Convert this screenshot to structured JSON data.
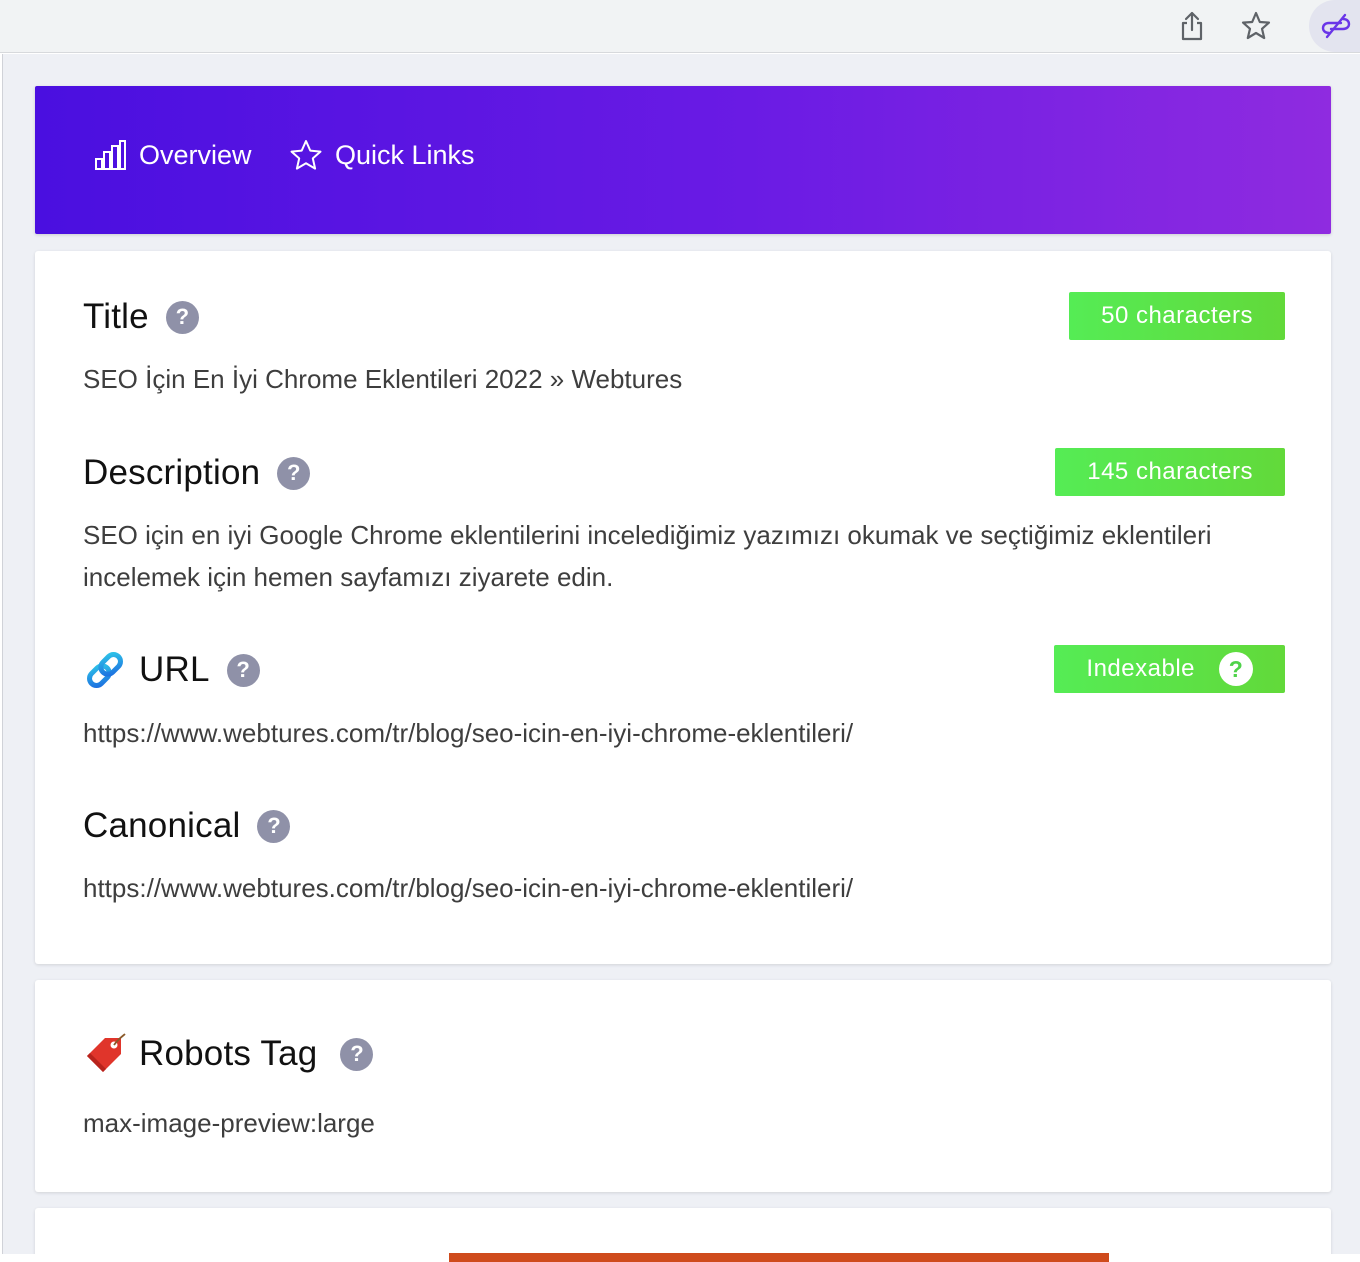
{
  "browser": {
    "share_icon": "share-icon",
    "bookmark_icon": "star-icon",
    "extension_icon": "seo-extension-icon"
  },
  "nav": {
    "overview_label": "Overview",
    "overview_icon": "bar-chart-icon",
    "quick_links_label": "Quick Links",
    "quick_links_icon": "star-outline-icon",
    "gradient_colors": [
      "#4a0fe0",
      "#8f2be0"
    ]
  },
  "fields": {
    "title": {
      "label": "Title",
      "help": "?",
      "badge": "50 characters",
      "value": "SEO İçin En İyi Chrome Eklentileri 2022 » Webtures"
    },
    "description": {
      "label": "Description",
      "help": "?",
      "badge": "145 characters",
      "value": "SEO için en iyi Google Chrome eklentilerini incelediğimiz yazımızı okumak ve seçtiğimiz eklentileri incelemek için hemen sayfamızı ziyarete edin."
    },
    "url": {
      "label": "URL",
      "icon": "link-icon",
      "help": "?",
      "badge": "Indexable",
      "badge_help": "?",
      "value": "https://www.webtures.com/tr/blog/seo-icin-en-iyi-chrome-eklentileri/"
    },
    "canonical": {
      "label": "Canonical",
      "help": "?",
      "value": "https://www.webtures.com/tr/blog/seo-icin-en-iyi-chrome-eklentileri/"
    }
  },
  "robots": {
    "label": "Robots Tag",
    "icon": "tag-icon",
    "help": "?",
    "value": "max-image-preview:large"
  },
  "colors": {
    "badge_green": "#55ec55",
    "help_gray": "#8f91a8",
    "accent_purple": "#6a1be4"
  }
}
